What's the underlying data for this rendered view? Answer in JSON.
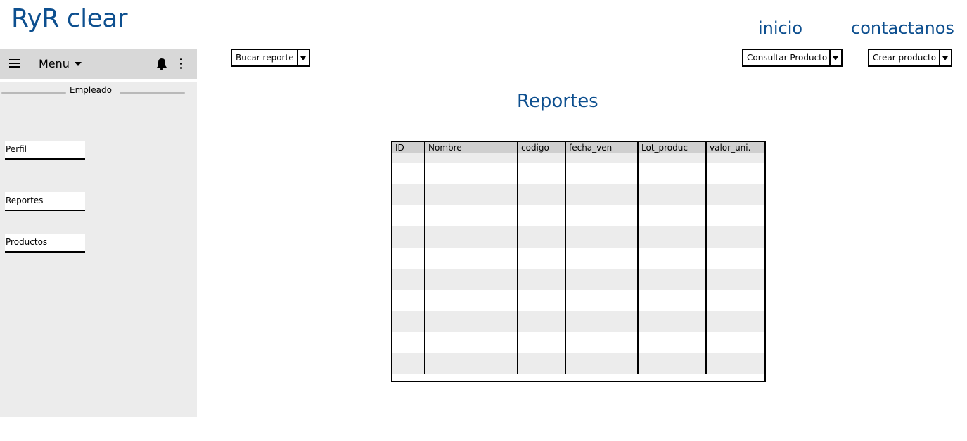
{
  "brand": {
    "title": "RyR clear"
  },
  "top_nav": {
    "inicio": "inicio",
    "contact": "contactanos"
  },
  "menubar": {
    "label": "Menu"
  },
  "sidebar": {
    "section_label": "Empleado",
    "items": [
      {
        "label": "Perfil"
      },
      {
        "label": "Reportes"
      },
      {
        "label": "Productos"
      }
    ]
  },
  "toolbar": {
    "bucar": "Bucar reporte",
    "consultar": "Consultar Producto",
    "crear": "Crear producto"
  },
  "main": {
    "title": "Reportes",
    "table": {
      "columns": [
        "ID",
        "Nombre",
        "codigo",
        "fecha_ven",
        "Lot_produc",
        "valor_uni."
      ],
      "rows": [
        [
          "",
          "",
          "",
          "",
          "",
          ""
        ],
        [
          "",
          "",
          "",
          "",
          "",
          ""
        ],
        [
          "",
          "",
          "",
          "",
          "",
          ""
        ],
        [
          "",
          "",
          "",
          "",
          "",
          ""
        ],
        [
          "",
          "",
          "",
          "",
          "",
          ""
        ],
        [
          "",
          "",
          "",
          "",
          "",
          ""
        ],
        [
          "",
          "",
          "",
          "",
          "",
          ""
        ],
        [
          "",
          "",
          "",
          "",
          "",
          ""
        ],
        [
          "",
          "",
          "",
          "",
          "",
          ""
        ],
        [
          "",
          "",
          "",
          "",
          "",
          ""
        ],
        [
          "",
          "",
          "",
          "",
          "",
          ""
        ]
      ]
    }
  },
  "icons": [
    "hamburger-icon",
    "chevron-down-icon",
    "bell-icon",
    "kebab-icon"
  ],
  "colors": {
    "accent": "#0d4f8f",
    "sidebar_bg": "#ececec",
    "menubar_bg": "#d8d8d8",
    "header_bg": "#cfcfcf"
  }
}
